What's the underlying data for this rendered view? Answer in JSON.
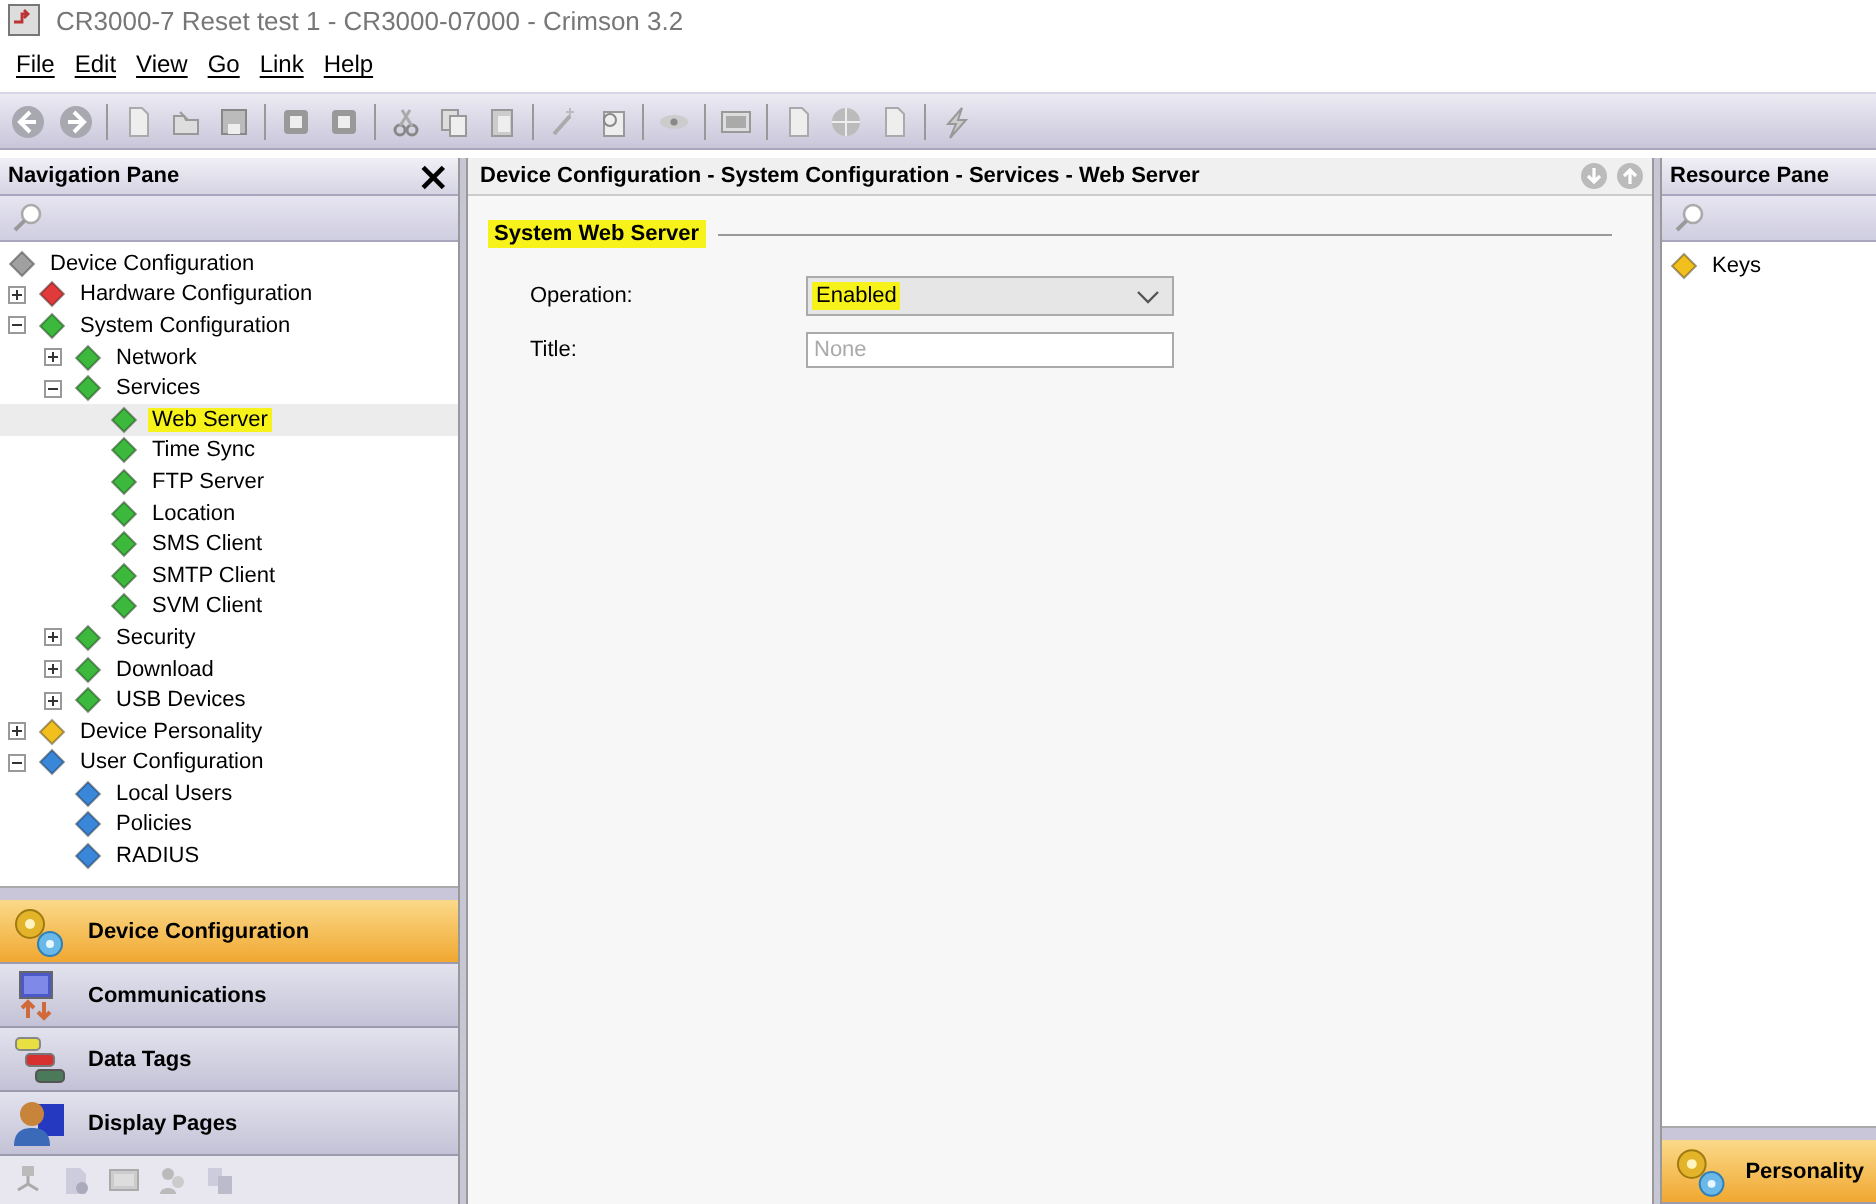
{
  "window": {
    "title": "CR3000-7 Reset test 1 - CR3000-07000 - Crimson 3.2"
  },
  "menu": [
    "File",
    "Edit",
    "View",
    "Go",
    "Link",
    "Help"
  ],
  "navigation_pane": {
    "title": "Navigation Pane",
    "close": "×",
    "tree": [
      {
        "label": "Device Configuration",
        "color": "#a0a0a0",
        "selected": false,
        "highlighted": false,
        "children": [
          {
            "label": "Hardware Configuration",
            "color": "#e03a3a",
            "expanded": false,
            "selected": false,
            "highlighted": false
          },
          {
            "label": "System Configuration",
            "color": "#3cb83c",
            "expanded": true,
            "selected": false,
            "highlighted": false,
            "children": [
              {
                "label": "Network",
                "color": "#3cb83c",
                "expanded": false,
                "selected": false,
                "highlighted": false
              },
              {
                "label": "Services",
                "color": "#3cb83c",
                "expanded": true,
                "selected": false,
                "highlighted": false,
                "children": [
                  {
                    "label": "Web Server",
                    "color": "#3cb83c",
                    "selected": true,
                    "highlighted": true
                  },
                  {
                    "label": "Time Sync",
                    "color": "#3cb83c",
                    "selected": false,
                    "highlighted": false
                  },
                  {
                    "label": "FTP Server",
                    "color": "#3cb83c",
                    "selected": false,
                    "highlighted": false
                  },
                  {
                    "label": "Location",
                    "color": "#3cb83c",
                    "selected": false,
                    "highlighted": false
                  },
                  {
                    "label": "SMS Client",
                    "color": "#3cb83c",
                    "selected": false,
                    "highlighted": false
                  },
                  {
                    "label": "SMTP Client",
                    "color": "#3cb83c",
                    "selected": false,
                    "highlighted": false
                  },
                  {
                    "label": "SVM Client",
                    "color": "#3cb83c",
                    "selected": false,
                    "highlighted": false
                  }
                ]
              },
              {
                "label": "Security",
                "color": "#3cb83c",
                "expanded": false,
                "selected": false,
                "highlighted": false
              },
              {
                "label": "Download",
                "color": "#3cb83c",
                "expanded": false,
                "selected": false,
                "highlighted": false
              },
              {
                "label": "USB Devices",
                "color": "#3cb83c",
                "expanded": false,
                "selected": false,
                "highlighted": false
              }
            ]
          },
          {
            "label": "Device Personality",
            "color": "#f2c01e",
            "expanded": false,
            "selected": false,
            "highlighted": false
          },
          {
            "label": "User Configuration",
            "color": "#3a86d8",
            "expanded": true,
            "selected": false,
            "highlighted": false,
            "children": [
              {
                "label": "Local Users",
                "color": "#3a86d8",
                "selected": false,
                "highlighted": false
              },
              {
                "label": "Policies",
                "color": "#3a86d8",
                "selected": false,
                "highlighted": false
              },
              {
                "label": "RADIUS",
                "color": "#3a86d8",
                "selected": false,
                "highlighted": false
              }
            ]
          }
        ]
      }
    ],
    "categories": [
      {
        "label": "Device Configuration",
        "kind": "gears",
        "selected": true
      },
      {
        "label": "Communications",
        "kind": "monitor",
        "selected": false
      },
      {
        "label": "Data Tags",
        "kind": "tags",
        "selected": false
      },
      {
        "label": "Display Pages",
        "kind": "person",
        "selected": false
      }
    ]
  },
  "editor": {
    "breadcrumb": "Device Configuration - System Configuration - Services - Web Server",
    "section": {
      "title": "System Web Server",
      "highlighted": true
    },
    "fields": [
      {
        "label": "Operation:",
        "kind": "dropdown",
        "value": "Enabled",
        "highlighted": true
      },
      {
        "label": "Title:",
        "kind": "text",
        "placeholder": "None"
      }
    ]
  },
  "resource_pane": {
    "title": "Resource Pane",
    "items": [
      {
        "label": "Keys",
        "color": "#f2c01e"
      }
    ],
    "category": {
      "label": "Personality",
      "selected": true
    }
  }
}
